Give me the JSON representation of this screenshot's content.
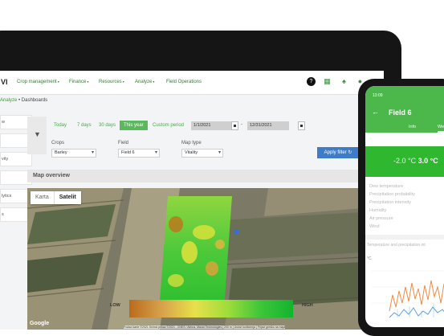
{
  "app": {
    "logo": "VI"
  },
  "nav": {
    "items": [
      {
        "label": "Crop management",
        "caret": "▾"
      },
      {
        "label": "Finance",
        "caret": "▾"
      },
      {
        "label": "Resources",
        "caret": "▾"
      },
      {
        "label": "Analyze",
        "caret": "▾"
      },
      {
        "label": "Field Operations",
        "caret": ""
      }
    ],
    "icons": [
      "help-icon",
      "calendar-icon",
      "bell-icon",
      "chat-icon",
      "user-avatar-icon"
    ]
  },
  "breadcrumb": {
    "part1": "Analyze",
    "sep": " • ",
    "part2": "Dashboards"
  },
  "sidebar": {
    "items": [
      "w",
      "",
      "vity",
      "",
      "lytics",
      "s"
    ]
  },
  "filters": {
    "periods": [
      "Today",
      "7 days",
      "30 days",
      "This year",
      "Custom period"
    ],
    "active_period": "This year",
    "date_from": "1/1/2021",
    "date_to": "12/31/2021",
    "date_sep": "-",
    "crops_label": "Crops",
    "crops_value": "Barley",
    "field_label": "Field",
    "field_value": "Field 6",
    "maptype_label": "Map type",
    "maptype_value": "Vitality",
    "apply_label": "Apply filter ↻"
  },
  "map": {
    "header": "Map overview",
    "toggle": [
      "Karta",
      "Satelit"
    ],
    "selected_toggle": "Satelit",
    "google": "Google",
    "attribution": "Podaci karte ©2021 Snimci prikaz ©2021 , CNES / Airbus, Maxar Technologies | 200 m | Uslovi korišćenja | Prijavi grešku na mapi"
  },
  "legend": {
    "low": "LOW",
    "high": "HIGH",
    "colors": [
      "#b96b1c",
      "#d7a24b",
      "#e8e04a",
      "#9fdd3a",
      "#3ec63a",
      "#13b32d"
    ]
  },
  "phone": {
    "time": "13:09",
    "back": "←",
    "title": "Field 6",
    "tabs": [
      "Info",
      "Weat"
    ],
    "temp_min": "-2.0 °C",
    "temp_max": "3.0 °C",
    "rows": [
      "Dew temperature",
      "Precipitation probability",
      "Precipitation intensity",
      "Humidity",
      "Air pressure",
      "Wind"
    ],
    "chart_title": "Temperature and precipitation int",
    "chart_unit": "°C"
  },
  "colors": {
    "brand_green": "#4cb84c",
    "apply_blue": "#3e7cc9"
  }
}
